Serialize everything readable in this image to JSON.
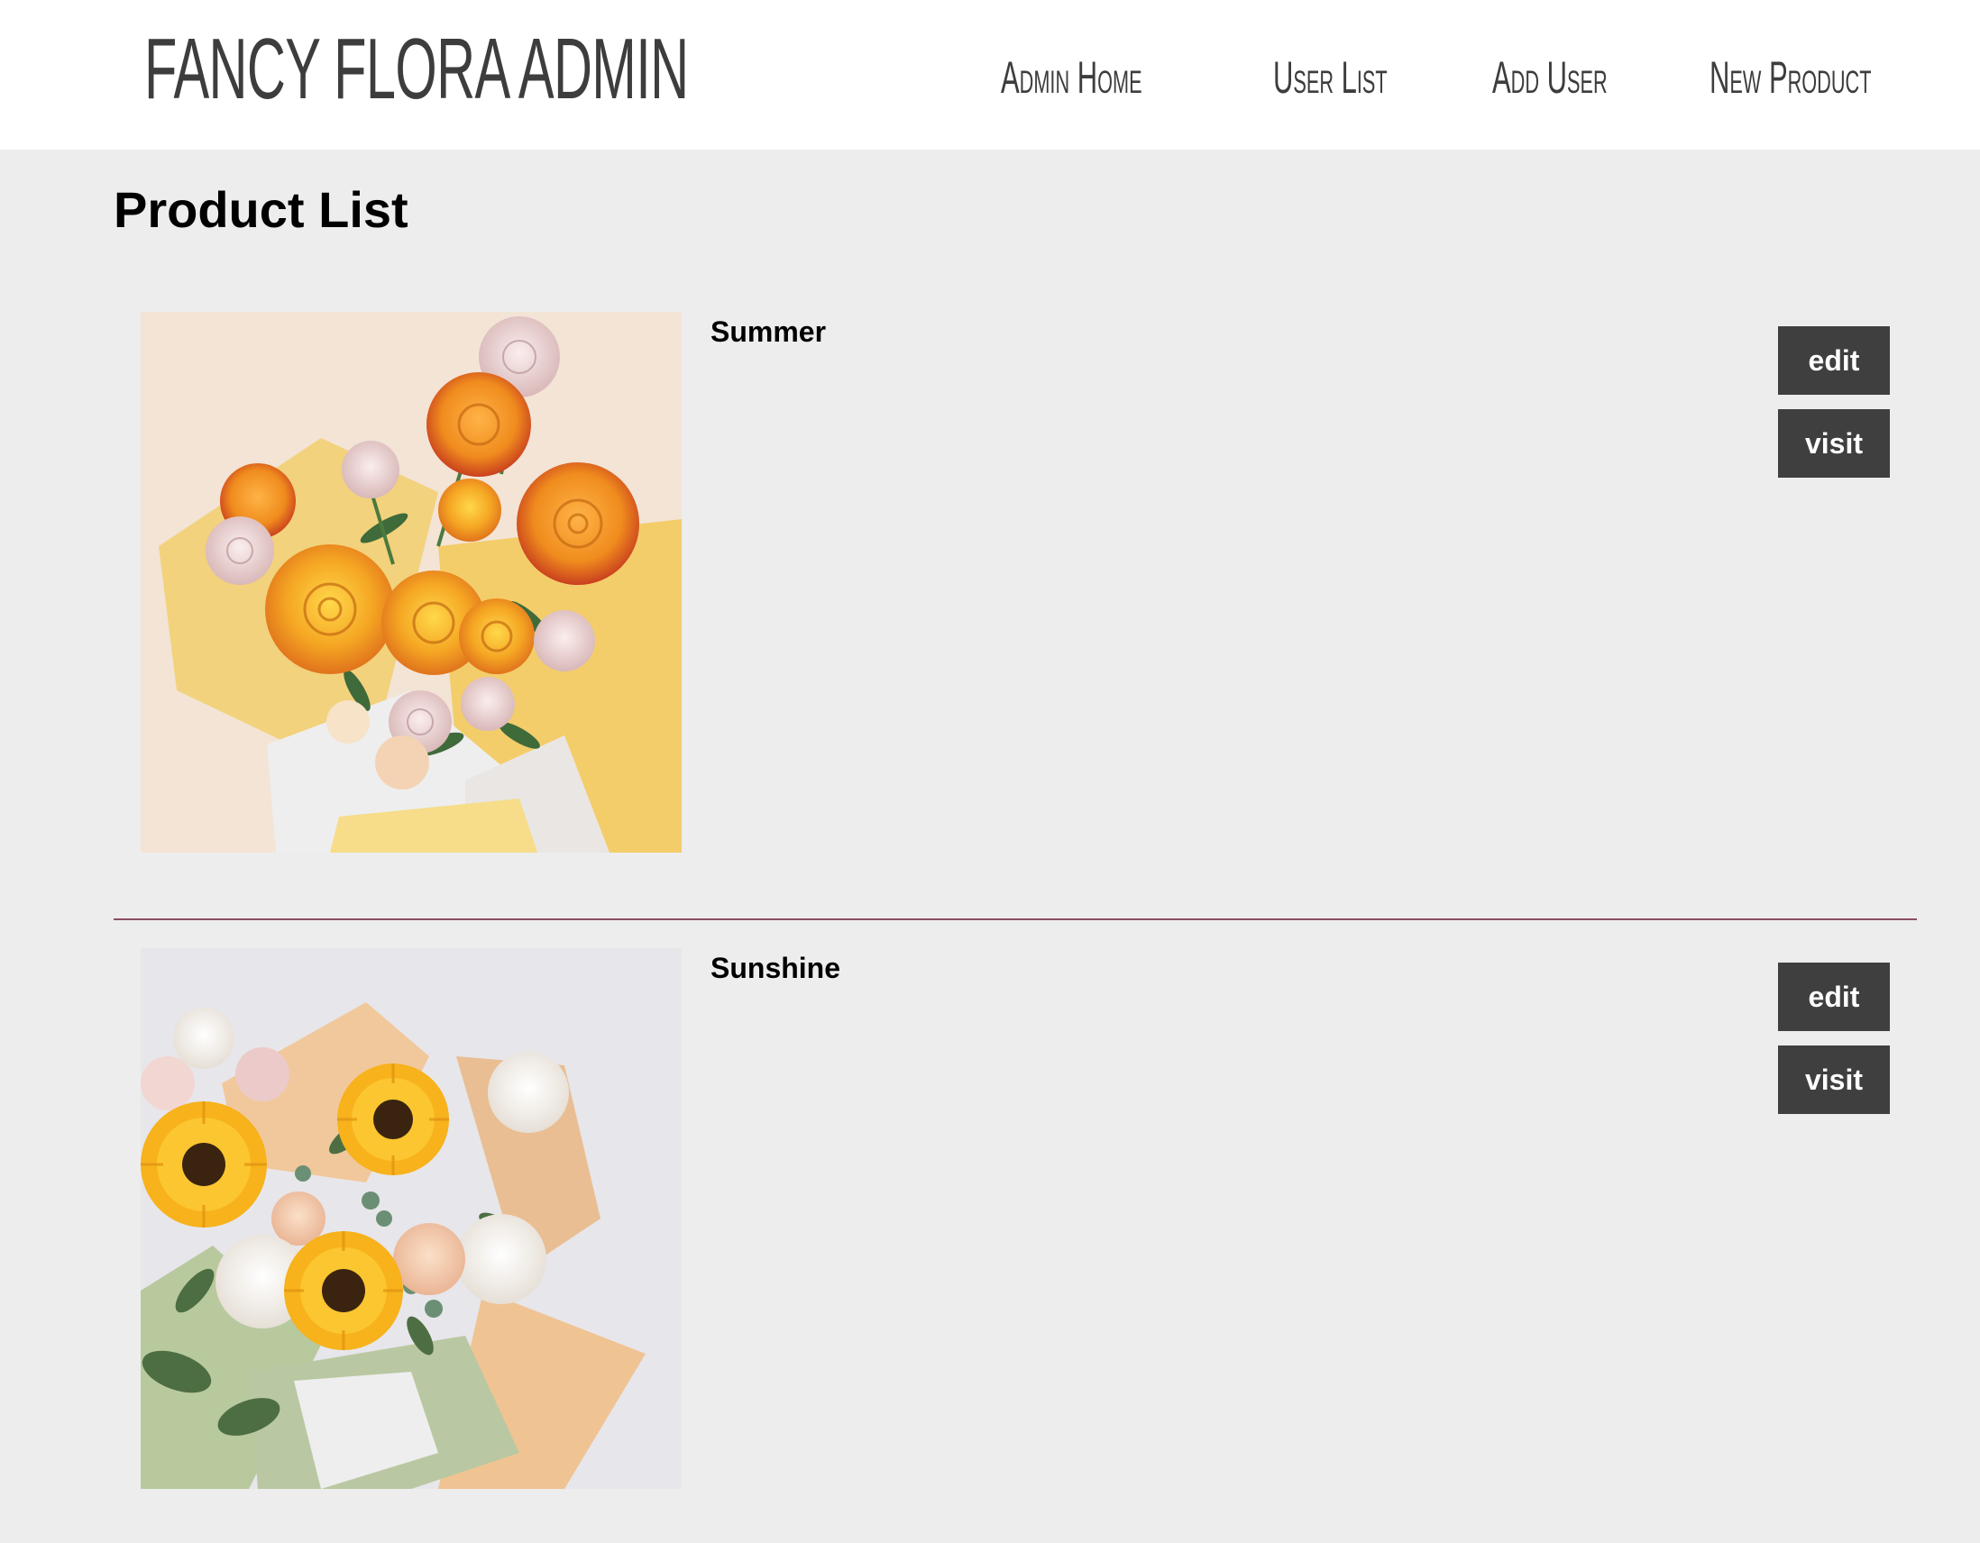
{
  "header": {
    "brand": "FANCY FLORA ADMIN",
    "nav": [
      {
        "label": "Admin Home"
      },
      {
        "label": "User List"
      },
      {
        "label": "Add User"
      },
      {
        "label": "New Product"
      }
    ]
  },
  "page": {
    "title": "Product List"
  },
  "products": [
    {
      "name": "Summer",
      "edit_label": "edit",
      "visit_label": "visit",
      "image": "yellow-roses-bouquet"
    },
    {
      "name": "Sunshine",
      "edit_label": "edit",
      "visit_label": "visit",
      "image": "sunflower-bouquet"
    }
  ],
  "colors": {
    "background": "#ededed",
    "header_bg": "#ffffff",
    "button_bg": "#3f3f3f",
    "divider": "#8b4d61",
    "text": "#000000"
  }
}
